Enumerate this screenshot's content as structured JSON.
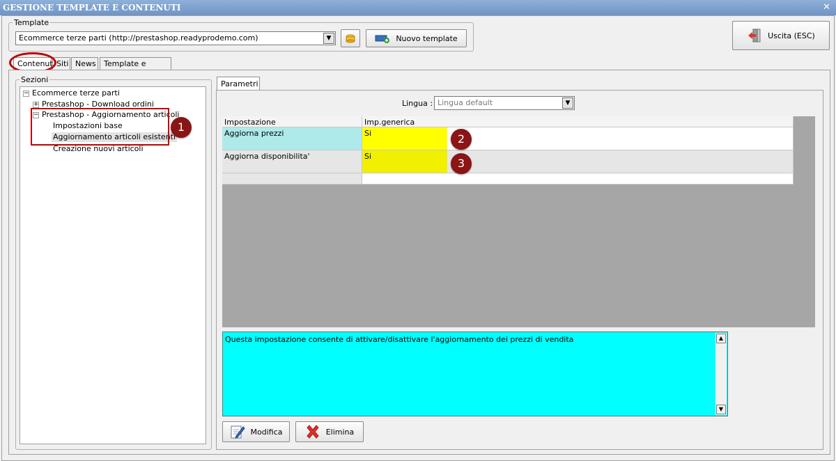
{
  "window": {
    "title": "GESTIONE TEMPLATE E CONTENUTI",
    "close_label": "✕"
  },
  "template_group": {
    "legend": "Template",
    "selected": "Ecommerce terze parti (http://prestashop.readyprodemo.com)",
    "new_label": "Nuovo template"
  },
  "exit_button": {
    "label": "Uscita (ESC)"
  },
  "tabs": [
    {
      "label": "Contenuti",
      "active": true
    },
    {
      "label": "Siti"
    },
    {
      "label": "News"
    },
    {
      "label": "Template e plugins"
    }
  ],
  "sections": {
    "legend": "Sezioni",
    "root": "Ecommerce terze parti",
    "items": [
      {
        "label": "Prestashop - Download ordini",
        "expander": "+"
      },
      {
        "label": "Prestashop - Aggiornamento articoli",
        "expander": "−"
      },
      {
        "label": "Impostazioni base"
      },
      {
        "label": "Aggiornamento articoli esistenti",
        "selected": true
      },
      {
        "label": "Creazione nuovi articoli"
      }
    ]
  },
  "parametri": {
    "tab_label": "Parametri",
    "lingua_label": "Lingua :",
    "lingua_value": "Lingua default",
    "columns": [
      "Impostazione",
      "Imp.generica"
    ],
    "rows": [
      {
        "setting": "Aggiorna prezzi",
        "value": "Si"
      },
      {
        "setting": "Aggiorna disponibilita'",
        "value": "Si"
      }
    ],
    "description": "Questa impostazione consente di attivare/disattivare l'aggiornamento dei prezzi di vendita",
    "modify_label": "Modifica",
    "delete_label": "Elimina"
  },
  "markers": [
    "1",
    "2",
    "3"
  ],
  "colors": {
    "highlight_red": "#c00000",
    "cyan": "#00ffff",
    "yellow": "#ffff00",
    "row_selected": "#aeeaea",
    "badge": "#8b1414"
  }
}
